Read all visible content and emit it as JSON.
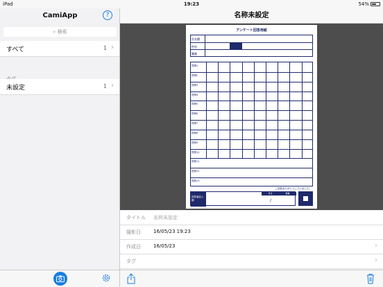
{
  "status": {
    "device": "iPad",
    "time": "19:23",
    "battery": "54%"
  },
  "sidebar": {
    "title": "CamiApp",
    "search_placeholder": "検索",
    "all": {
      "label": "すべて",
      "count": "1"
    },
    "tags_header": "タグ",
    "tag_items": [
      {
        "label": "未設定",
        "count": "1"
      }
    ]
  },
  "main": {
    "title": "名称未設定",
    "document": {
      "heading": "アンケート回答用紙",
      "labels": [
        "氏名欄",
        "性別",
        "職業"
      ],
      "rows": [
        "質問1",
        "質問2",
        "質問3",
        "質問4",
        "質問5",
        "質問6",
        "質問7",
        "質問8",
        "質問9",
        "質問10",
        "質問11",
        "質問12",
        "質問13"
      ],
      "footer_label": "回答者記入欄",
      "footer_cols": [
        "日付",
        "部署"
      ],
      "footer_note": "ご回答ありがとうございました。"
    },
    "fields": [
      {
        "key": "タイトル",
        "value": "名称未設定",
        "placeholder": true
      },
      {
        "key": "撮影日",
        "value": "16/05/23 19:23"
      },
      {
        "key": "作成日",
        "value": "16/05/23"
      },
      {
        "key": "タグ",
        "value": ""
      }
    ]
  },
  "colors": {
    "accent": "#1a7ee0",
    "form": "#1e2a6a"
  }
}
